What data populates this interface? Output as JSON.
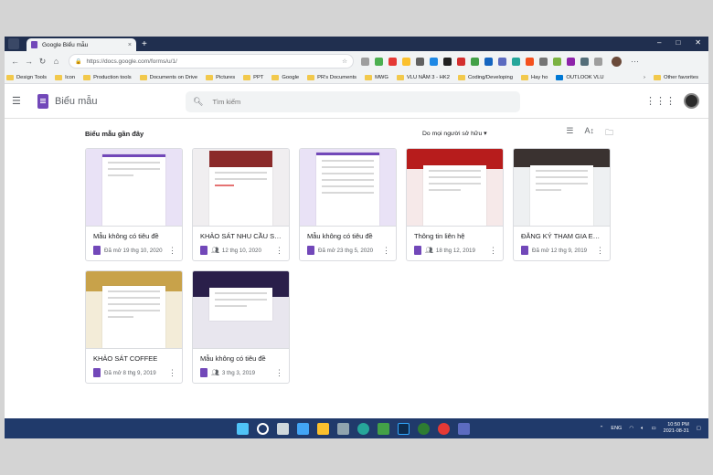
{
  "browser": {
    "tab_title": "Google Biểu mẫu",
    "tab_close": "×",
    "new_tab": "+",
    "url": "https://docs.google.com/forms/u/1/",
    "window_controls": [
      "–",
      "□",
      "✕"
    ],
    "nav": [
      "←",
      "→",
      "↻",
      "⌂"
    ]
  },
  "bookmarks": {
    "items": [
      "Design Tools",
      "Icon",
      "Production tools",
      "Documents on Drive",
      "Pictures",
      "PPT",
      "Google",
      "PR's Documents",
      "MWG",
      "VLU NĂM 3 - HK2",
      "Coding/Developing",
      "Hay ho",
      "OUTLOOK VLU"
    ],
    "more": "›",
    "other": "Other favorites"
  },
  "header": {
    "app_name": "Biểu mẫu",
    "search_placeholder": "Tìm kiếm"
  },
  "recent": {
    "title": "Biểu mẫu gần đây",
    "owner_filter": "Do mọi người sở hữu ▾",
    "cards": [
      {
        "title": "Mẫu không có tiêu đề",
        "opened": "Đã mở 19 thg 10, 2020",
        "shared": false
      },
      {
        "title": "KHẢO SÁT NHU CẦU SỬ D...",
        "opened": "12 thg 10, 2020",
        "shared": true
      },
      {
        "title": "Mẫu không có tiêu đề",
        "opened": "Đã mở 23 thg 5, 2020",
        "shared": false
      },
      {
        "title": "Thông tin liên hệ",
        "opened": "18 thg 12, 2019",
        "shared": true
      },
      {
        "title": "ĐĂNG KÝ THAM GIA EVE...",
        "opened": "Đã mở 12 thg 9, 2019",
        "shared": false
      },
      {
        "title": "KHẢO SÁT COFFEE",
        "opened": "Đã mở 8 thg 9, 2019",
        "shared": false
      },
      {
        "title": "Mẫu không có tiêu đề",
        "opened": "3 thg 3, 2019",
        "shared": true
      }
    ]
  },
  "taskbar": {
    "lang": "ENG",
    "time": "10:50 PM",
    "date": "2021-08-31"
  },
  "colors": {
    "forms_purple": "#7248b9",
    "titlebar": "#202f4f",
    "taskbar": "#203a6b"
  }
}
